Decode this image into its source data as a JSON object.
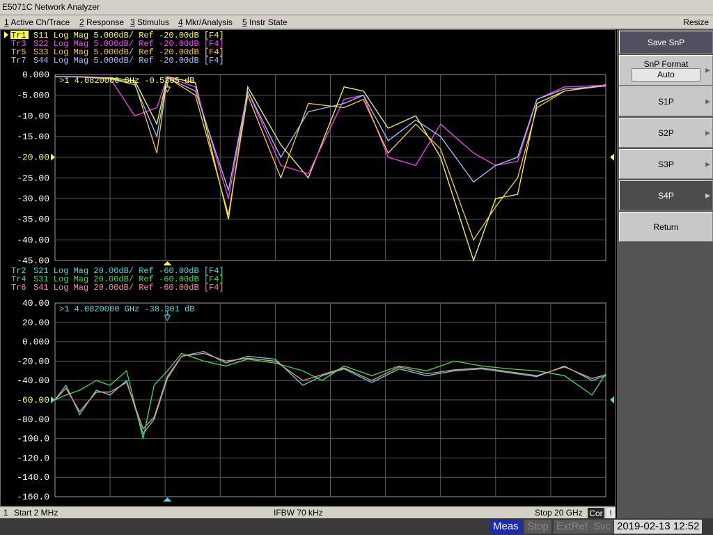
{
  "app": {
    "title": "E5071C Network Analyzer"
  },
  "menu": {
    "items": [
      {
        "key": "1",
        "label": "Active Ch/Trace"
      },
      {
        "key": "2",
        "label": "Response"
      },
      {
        "key": "3",
        "label": "Stimulus"
      },
      {
        "key": "4",
        "label": "Mkr/Analysis"
      },
      {
        "key": "5",
        "label": "Instr State"
      }
    ],
    "resize": "Resize"
  },
  "upper": {
    "traces": [
      {
        "tr": "Tr1",
        "text": "S11 Log Mag 5.000dB/ Ref -20.00dB [F4]",
        "color": "#ffff40",
        "active": true
      },
      {
        "tr": "Tr3",
        "text": "S22 Log Mag 5.000dB/ Ref -20.00dB [F4]",
        "color": "#ff40ff"
      },
      {
        "tr": "Tr5",
        "text": "S33 Log Mag 5.000dB/ Ref -20.00dB [F4]",
        "color": "#ffd020"
      },
      {
        "tr": "Tr7",
        "text": "S44 Log Mag 5.000dB/ Ref -20.00dB [F4]",
        "color": "#a0c8ff"
      }
    ],
    "marker": ">1   4.0820000 GHz -0.5305 dB",
    "marker_label": "1",
    "marker_color": "#ffff40",
    "y_labels": [
      "0.000",
      "-5.000",
      "-10.00",
      "-15.00",
      "-20.00",
      "-25.00",
      "-30.00",
      "-35.00",
      "-40.00",
      "-45.00"
    ],
    "ref_label": "-20.00"
  },
  "lower": {
    "traces": [
      {
        "tr": "Tr2",
        "text": "S21 Log Mag 20.00dB/ Ref -60.00dB [F4]",
        "color": "#40e0e0"
      },
      {
        "tr": "Tr4",
        "text": "S31 Log Mag 20.00dB/ Ref -60.00dB [F4]",
        "color": "#40e040"
      },
      {
        "tr": "Tr6",
        "text": "S41 Log Mag 20.00dB/ Ref -60.00dB [F4]",
        "color": "#ff9090"
      }
    ],
    "marker": ">1   4.0820000 GHz -38.301 dB",
    "marker_label": "1",
    "marker_color": "#40e0e0",
    "y_labels": [
      "40.00",
      "20.00",
      "0.000",
      "-20.00",
      "-40.00",
      "-60.00",
      "-80.00",
      "-100.0",
      "-120.0",
      "-140.0",
      "-160.0"
    ],
    "ref_label": "-60.00"
  },
  "chart_data": [
    {
      "type": "line",
      "title": "",
      "xlabel": "",
      "ylabel": "",
      "x_unit": "GHz",
      "xlim": [
        0.002,
        20
      ],
      "ylim": [
        -45,
        0
      ],
      "series": [
        {
          "name": "S11",
          "color": "#ffff40",
          "x": [
            0.002,
            1.0,
            2.0,
            2.9,
            3.7,
            4.08,
            5.1,
            6.3,
            7.0,
            8.2,
            9.2,
            10.5,
            11.2,
            12.1,
            13.1,
            14.0,
            15.2,
            16.0,
            16.8,
            17.5,
            18.5,
            20.0
          ],
          "values": [
            -0.5,
            -0.5,
            -0.8,
            -1.5,
            -12,
            -0.5,
            -2,
            -35,
            -3,
            -17,
            -25,
            -3,
            -4,
            -13,
            -10,
            -20,
            -45,
            -30,
            -29,
            -7,
            -4,
            -2.5
          ]
        },
        {
          "name": "S22",
          "color": "#ff40ff",
          "x": [
            0.002,
            1.0,
            2.0,
            2.9,
            3.7,
            4.08,
            5.1,
            6.3,
            7.0,
            8.2,
            9.2,
            10.5,
            11.2,
            12.1,
            13.1,
            14.0,
            15.2,
            16.0,
            16.8,
            17.5,
            18.5,
            20.0
          ],
          "values": [
            -0.5,
            -0.5,
            -0.9,
            -10,
            -8,
            -0.6,
            -3,
            -30,
            -4,
            -22,
            -24,
            -6,
            -5,
            -20,
            -22,
            -12,
            -19,
            -22,
            -21,
            -6,
            -3,
            -2.6
          ]
        },
        {
          "name": "S33",
          "color": "#ffd020",
          "x": [
            0.002,
            1.0,
            2.0,
            2.9,
            3.7,
            4.08,
            5.1,
            6.3,
            7.0,
            8.2,
            9.2,
            10.5,
            11.2,
            12.1,
            13.1,
            14.0,
            15.2,
            16.0,
            16.8,
            17.5,
            18.5,
            20.0
          ],
          "values": [
            -0.5,
            -0.6,
            -1.0,
            -2,
            -19,
            -0.7,
            -5,
            -34,
            -5,
            -25,
            -7,
            -8,
            -6,
            -19,
            -12,
            -18,
            -40,
            -32,
            -25,
            -8,
            -4,
            -2.7
          ]
        },
        {
          "name": "S44",
          "color": "#a0c8ff",
          "x": [
            0.002,
            1.0,
            2.0,
            2.9,
            3.7,
            4.08,
            5.1,
            6.3,
            7.0,
            8.2,
            9.2,
            10.5,
            11.2,
            12.1,
            13.1,
            14.0,
            15.2,
            16.0,
            16.8,
            17.5,
            18.5,
            20.0
          ],
          "values": [
            -0.5,
            -0.6,
            -1.0,
            -2.5,
            -15,
            -0.8,
            -4,
            -28,
            -4,
            -20,
            -9,
            -7,
            -5,
            -16,
            -11,
            -15,
            -26,
            -22,
            -20,
            -6,
            -3.5,
            -2.8
          ]
        }
      ]
    },
    {
      "type": "line",
      "title": "",
      "xlabel": "",
      "ylabel": "",
      "x_unit": "GHz",
      "xlim": [
        0.002,
        20
      ],
      "ylim": [
        -160,
        40
      ],
      "series": [
        {
          "name": "S21",
          "color": "#40e0e0",
          "x": [
            0.002,
            0.4,
            0.9,
            1.5,
            2.0,
            2.6,
            3.2,
            3.6,
            4.08,
            4.6,
            5.4,
            6.2,
            7.0,
            8.0,
            9.0,
            9.7,
            10.5,
            11.5,
            12.5,
            13.5,
            14.5,
            15.5,
            16.5,
            17.5,
            18.5,
            19.5,
            20.0
          ],
          "values": [
            -60,
            -45,
            -75,
            -50,
            -55,
            -40,
            -95,
            -80,
            -38,
            -15,
            -10,
            -22,
            -15,
            -18,
            -45,
            -35,
            -28,
            -42,
            -28,
            -35,
            -30,
            -28,
            -32,
            -36,
            -25,
            -40,
            -35
          ]
        },
        {
          "name": "S31",
          "color": "#40e040",
          "x": [
            0.002,
            0.4,
            0.9,
            1.5,
            2.0,
            2.6,
            3.2,
            3.6,
            4.08,
            4.6,
            5.4,
            6.2,
            7.0,
            8.0,
            9.0,
            9.7,
            10.5,
            11.5,
            12.5,
            13.5,
            14.5,
            15.5,
            16.5,
            17.5,
            18.5,
            19.5,
            20.0
          ],
          "values": [
            -60,
            -55,
            -50,
            -40,
            -45,
            -30,
            -100,
            -45,
            -30,
            -12,
            -20,
            -25,
            -18,
            -22,
            -30,
            -40,
            -25,
            -35,
            -25,
            -30,
            -20,
            -25,
            -28,
            -30,
            -35,
            -55,
            -33
          ]
        },
        {
          "name": "S41",
          "color": "#ff9090",
          "x": [
            0.002,
            0.4,
            0.9,
            1.5,
            2.0,
            2.6,
            3.2,
            3.6,
            4.08,
            4.6,
            5.4,
            6.2,
            7.0,
            8.0,
            9.0,
            9.7,
            10.5,
            11.5,
            12.5,
            13.5,
            14.5,
            15.5,
            16.5,
            17.5,
            18.5,
            19.5,
            20.0
          ],
          "values": [
            -60,
            -48,
            -72,
            -52,
            -52,
            -42,
            -90,
            -78,
            -36,
            -15,
            -12,
            -20,
            -17,
            -20,
            -40,
            -34,
            -27,
            -40,
            -26,
            -33,
            -29,
            -27,
            -31,
            -35,
            -26,
            -38,
            -34
          ]
        }
      ]
    }
  ],
  "status": {
    "channel": "1",
    "start": "Start 2 MHz",
    "ifbw": "IFBW 70 kHz",
    "stop": "Stop 20 GHz",
    "cor": "Cor",
    "warn": "!"
  },
  "softkeys": {
    "title": "Save SnP",
    "format_label": "SnP Format",
    "format_value": "Auto",
    "s1p": "S1P",
    "s2p": "S2P",
    "s3p": "S3P",
    "s4p": "S4P",
    "return": "Return"
  },
  "bottom": {
    "meas": "Meas",
    "stop": "Stop",
    "extref": "ExtRef",
    "svc": "Svc",
    "datetime": "2019-02-13 12:52"
  }
}
